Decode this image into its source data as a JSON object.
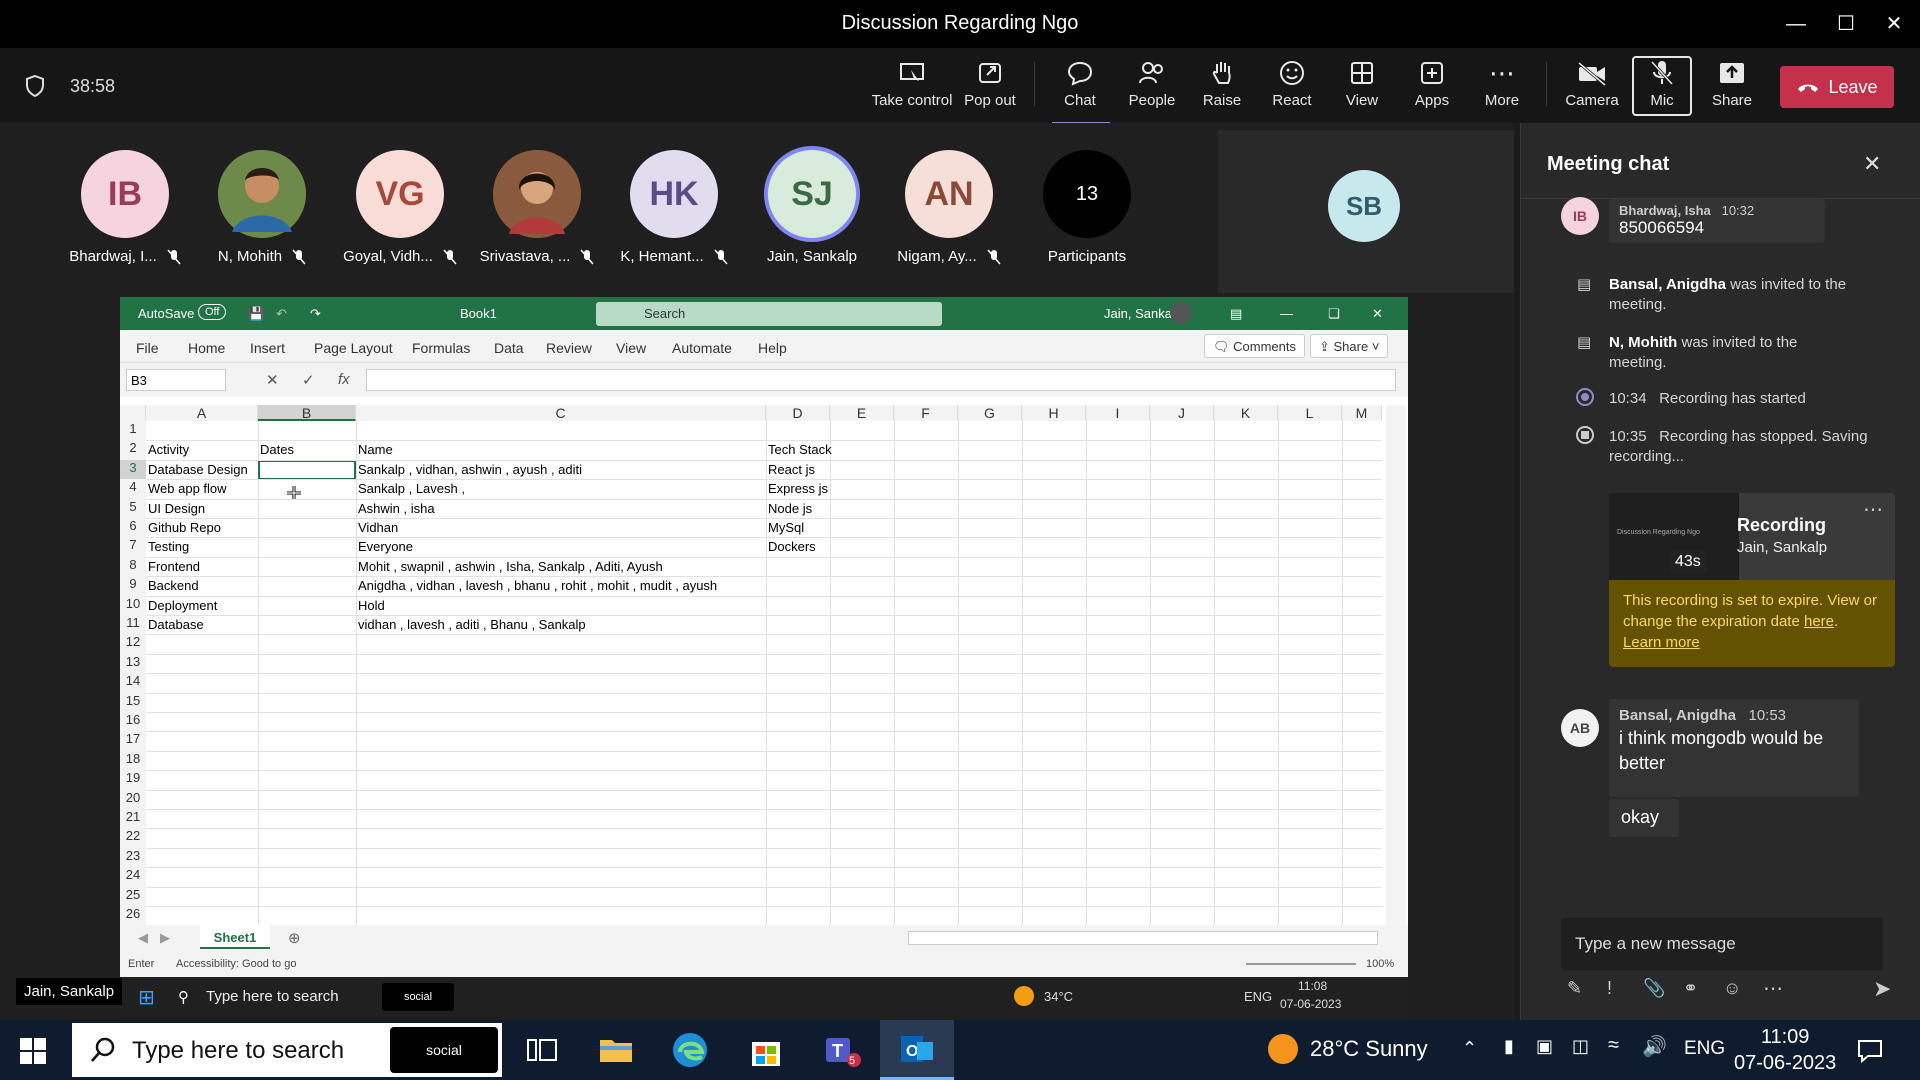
{
  "window": {
    "title": "Discussion Regarding Ngo"
  },
  "meeting": {
    "timer": "38:58"
  },
  "toolbar": {
    "take_control": "Take control",
    "pop_out": "Pop out",
    "chat": "Chat",
    "people": "People",
    "raise": "Raise",
    "react": "React",
    "view": "View",
    "apps": "Apps",
    "more": "More",
    "camera": "Camera",
    "mic": "Mic",
    "share": "Share",
    "leave": "Leave"
  },
  "participants": [
    {
      "initials": "IB",
      "name": "Bhardwaj, I...",
      "color": "#f5d3df"
    },
    {
      "initials": "",
      "name": "N, Mohith",
      "color": "#4b6b3b"
    },
    {
      "initials": "VG",
      "name": "Goyal, Vidh...",
      "color": "#f9dcd7"
    },
    {
      "initials": "",
      "name": "Srivastava, ...",
      "color": "#7a3f2f"
    },
    {
      "initials": "HK",
      "name": "K, Hemant...",
      "color": "#e2dcef"
    },
    {
      "initials": "SJ",
      "name": "Jain, Sankalp",
      "color": "#d9ecdc"
    },
    {
      "initials": "AN",
      "name": "Nigam, Ay...",
      "color": "#f6dfd8"
    },
    {
      "initials": "13",
      "name": "Participants",
      "color": "#000000"
    }
  ],
  "spotlight": {
    "initials": "SB"
  },
  "self_label": "Jain, Sankalp",
  "excel": {
    "autosave": "AutoSave",
    "autosave_state": "Off",
    "book": "Book1",
    "search": "Search",
    "user": "Jain, Sankalp",
    "tabs": [
      "File",
      "Home",
      "Insert",
      "Page Layout",
      "Formulas",
      "Data",
      "Review",
      "View",
      "Automate",
      "Help"
    ],
    "comments": "Comments",
    "share": "Share",
    "namebox": "B3",
    "columns": [
      "A",
      "B",
      "C",
      "D",
      "E",
      "F",
      "G",
      "H",
      "I",
      "J",
      "K",
      "L",
      "M"
    ],
    "rows": [
      "1",
      "2",
      "3",
      "4",
      "5",
      "6",
      "7",
      "8",
      "9",
      "10",
      "11",
      "12",
      "13",
      "14",
      "15",
      "16",
      "17",
      "18",
      "19",
      "20",
      "21",
      "22",
      "23",
      "24",
      "25",
      "26"
    ],
    "headers": {
      "a": "Activity",
      "b": "Dates",
      "c": "Name",
      "d": "Tech Stack"
    },
    "data": [
      {
        "a": "Database Design",
        "c": "Sankalp , vidhan, ashwin , ayush , aditi",
        "d": "React js"
      },
      {
        "a": "Web app flow",
        "c": "Sankalp , Lavesh ,",
        "d": "Express js"
      },
      {
        "a": "UI Design",
        "c": "Ashwin , isha",
        "d": "Node js"
      },
      {
        "a": "Github Repo",
        "c": "Vidhan",
        "d": "MySql"
      },
      {
        "a": "Testing",
        "c": "Everyone",
        "d": "Dockers"
      },
      {
        "a": "Frontend",
        "c": "Mohit , swapnil , ashwin , Isha, Sankalp , Aditi, Ayush",
        "d": ""
      },
      {
        "a": "Backend",
        "c": "Anigdha , vidhan , lavesh ,  bhanu , rohit , mohit , mudit , ayush",
        "d": ""
      },
      {
        "a": "Deployment",
        "c": "Hold",
        "d": ""
      },
      {
        "a": "Database",
        "c": "vidhan , lavesh , aditi , Bhanu , Sankalp",
        "d": ""
      }
    ],
    "sheet": "Sheet1",
    "status_mode": "Enter",
    "accessibility": "Accessibility: Good to go",
    "zoom": "100%"
  },
  "inner_taskbar": {
    "search": "Type here to search",
    "social": "social",
    "weather": "34°C",
    "lang": "ENG",
    "time": "11:08",
    "date": "07-06-2023"
  },
  "chat": {
    "title": "Meeting chat",
    "msg1_author": "Bhardwaj, Isha",
    "msg1_time": "10:32",
    "msg1_text": "850066594",
    "msg1_initials": "IB",
    "event1_name": "Bansal, Anigdha",
    "event1_text": "was invited to the meeting.",
    "event2_name": "N, Mohith",
    "event2_text": "was invited to the meeting.",
    "event3_time": "10:34",
    "event3_text": "Recording has started",
    "event4_time": "10:35",
    "event4_text": "Recording has stopped. Saving recording...",
    "rec_title": "Recording",
    "rec_owner": "Jain, Sankalp",
    "rec_duration": "43s",
    "rec_thumb_title": "Discussion Regarding Ngo",
    "expire_text": "This recording is set to expire. View or change the expiration date",
    "expire_link": "here",
    "learn_more": "Learn more",
    "msg2_author": "Bansal, Anigdha",
    "msg2_time": "10:53",
    "msg2_text": "i think mongodb would be better",
    "msg2_initials": "AB",
    "msg3_text": "okay",
    "composer_placeholder": "Type a new message"
  },
  "taskbar": {
    "search": "Type here to search",
    "social": "social",
    "weather": "28°C  Sunny",
    "lang": "ENG",
    "time": "11:09",
    "date": "07-06-2023",
    "teams_badge": "5"
  }
}
